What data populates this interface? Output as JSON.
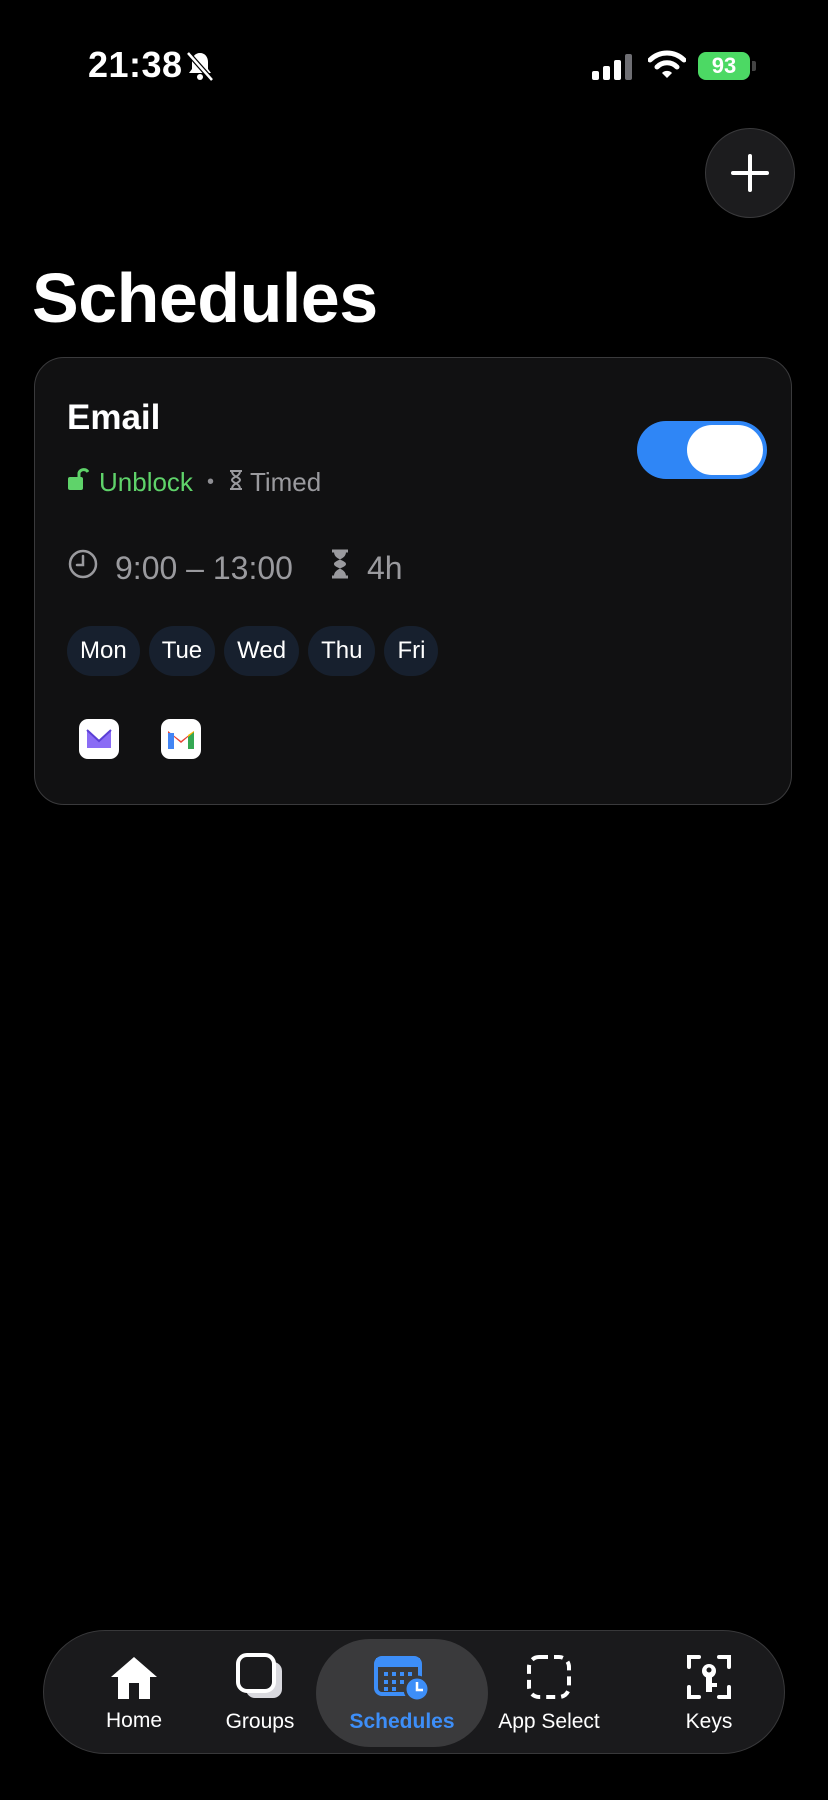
{
  "status_bar": {
    "time": "21:38",
    "battery": "93"
  },
  "page": {
    "title": "Schedules",
    "add_button_icon": "plus-icon"
  },
  "schedule_card": {
    "name": "Email",
    "mode": "Unblock",
    "type": "Timed",
    "time_range": "9:00 – 13:00",
    "duration": "4h",
    "enabled": true,
    "days": [
      "Mon",
      "Tue",
      "Wed",
      "Thu",
      "Fri"
    ],
    "apps": [
      "proton-mail-icon",
      "gmail-icon"
    ],
    "colors": {
      "unblock": "#5fd36a",
      "toggle_on": "#2f86f6",
      "day_chip": "#17202e"
    }
  },
  "tabbar": {
    "active": "Schedules",
    "items": [
      {
        "label": "Home",
        "icon": "home-icon"
      },
      {
        "label": "Groups",
        "icon": "groups-icon"
      },
      {
        "label": "Schedules",
        "icon": "schedule-calendar-icon"
      },
      {
        "label": "App Select",
        "icon": "app-select-icon"
      },
      {
        "label": "Keys",
        "icon": "key-icon"
      }
    ],
    "active_color": "#3d8ef8"
  }
}
